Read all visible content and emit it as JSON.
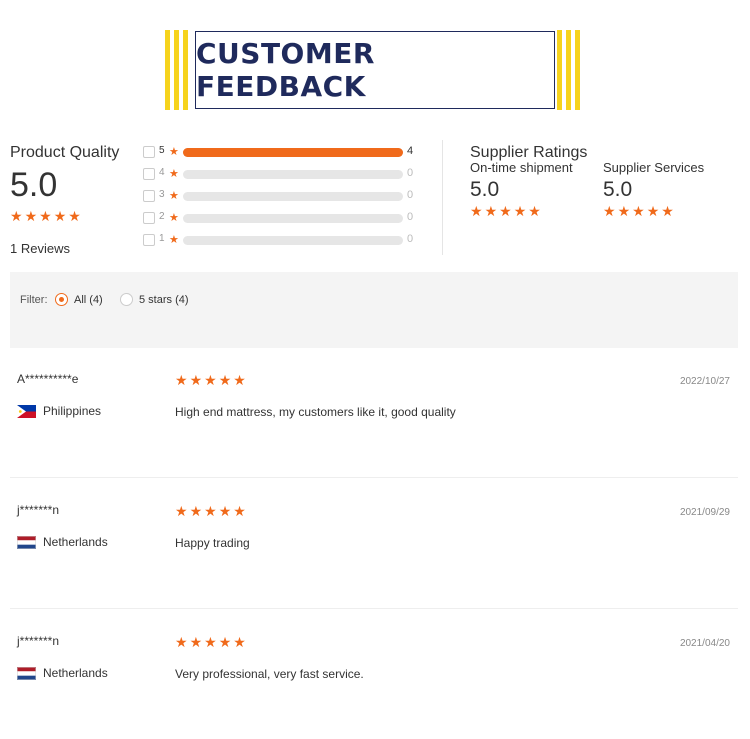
{
  "banner": {
    "title": "CUSTOMER FEEDBACK"
  },
  "product_quality": {
    "label": "Product Quality",
    "score": "5.0",
    "stars": 5,
    "reviews": "1 Reviews",
    "histogram": [
      {
        "stars": "5",
        "count": "4",
        "fill": 1.0
      },
      {
        "stars": "4",
        "count": "0",
        "fill": 0
      },
      {
        "stars": "3",
        "count": "0",
        "fill": 0
      },
      {
        "stars": "2",
        "count": "0",
        "fill": 0
      },
      {
        "stars": "1",
        "count": "0",
        "fill": 0
      }
    ]
  },
  "supplier_ratings": {
    "title": "Supplier Ratings",
    "on_time": {
      "label": "On-time shipment",
      "score": "5.0",
      "stars": 5
    },
    "services": {
      "label": "Supplier Services",
      "score": "5.0",
      "stars": 5
    }
  },
  "filter": {
    "label": "Filter:",
    "options": [
      {
        "label": "All (4)",
        "selected": true
      },
      {
        "label": "5 stars (4)",
        "selected": false
      }
    ]
  },
  "reviews": [
    {
      "name": "A**********e",
      "country": "Philippines",
      "flag": "philippines-flag-icon",
      "stars": 5,
      "text": "High end mattress, my customers like it, good quality",
      "date": "2022/10/27"
    },
    {
      "name": "j*******n",
      "country": "Netherlands",
      "flag": "netherlands-flag-icon",
      "stars": 5,
      "text": "Happy trading",
      "date": "2021/09/29"
    },
    {
      "name": "j*******n",
      "country": "Netherlands",
      "flag": "netherlands-flag-icon",
      "stars": 5,
      "text": "Very professional, very fast service.",
      "date": "2021/04/20"
    }
  ],
  "colors": {
    "accent": "#f06a1b",
    "banner_text": "#1f2a5c",
    "banner_stripes": "#f6d31d"
  }
}
